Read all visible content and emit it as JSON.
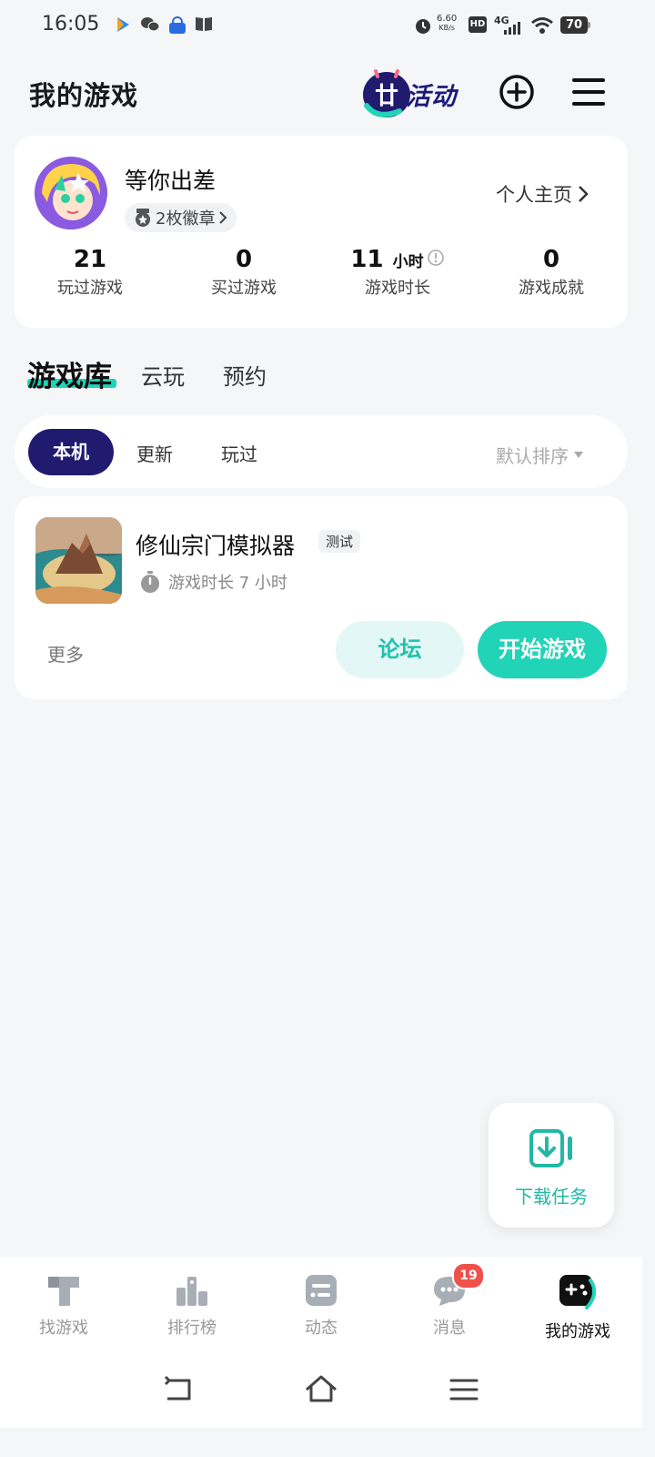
{
  "status_bar": {
    "time": "16:05",
    "speed_value": "6.60",
    "speed_unit": "KB/s",
    "hd": "HD",
    "network": "4G",
    "battery": "70"
  },
  "header": {
    "title": "我的游戏",
    "activity_label": "活动",
    "icons": [
      "add-icon",
      "menu-icon"
    ]
  },
  "profile": {
    "username": "等你出差",
    "badge_text": "2枚徽章",
    "profile_link": "个人主页",
    "stats": [
      {
        "value": "21",
        "unit": "",
        "label": "玩过游戏"
      },
      {
        "value": "0",
        "unit": "",
        "label": "买过游戏"
      },
      {
        "value": "11",
        "unit": "小时",
        "label": "游戏时长"
      },
      {
        "value": "0",
        "unit": "",
        "label": "游戏成就"
      }
    ]
  },
  "tabs": [
    {
      "label": "游戏库",
      "active": true
    },
    {
      "label": "云玩",
      "active": false
    },
    {
      "label": "预约",
      "active": false
    }
  ],
  "filters": {
    "items": [
      {
        "label": "本机",
        "active": true
      },
      {
        "label": "更新",
        "active": false
      },
      {
        "label": "玩过",
        "active": false
      }
    ],
    "sort": "默认排序"
  },
  "game": {
    "title": "修仙宗门模拟器",
    "tag": "测试",
    "playtime": "游戏时长 7 小时",
    "more": "更多",
    "forum": "论坛",
    "start": "开始游戏"
  },
  "download": {
    "label": "下载任务"
  },
  "bottom_nav": [
    {
      "label": "找游戏",
      "icon": "find-game-icon",
      "active": false
    },
    {
      "label": "排行榜",
      "icon": "ranking-icon",
      "active": false
    },
    {
      "label": "动态",
      "icon": "feed-icon",
      "active": false
    },
    {
      "label": "消息",
      "icon": "message-icon",
      "active": false,
      "badge": "19"
    },
    {
      "label": "我的游戏",
      "icon": "my-games-icon",
      "active": true
    }
  ],
  "colors": {
    "accent": "#21d3b7",
    "navy": "#201b6f",
    "background": "#f4f6f8",
    "badge_red": "#f0504a"
  }
}
